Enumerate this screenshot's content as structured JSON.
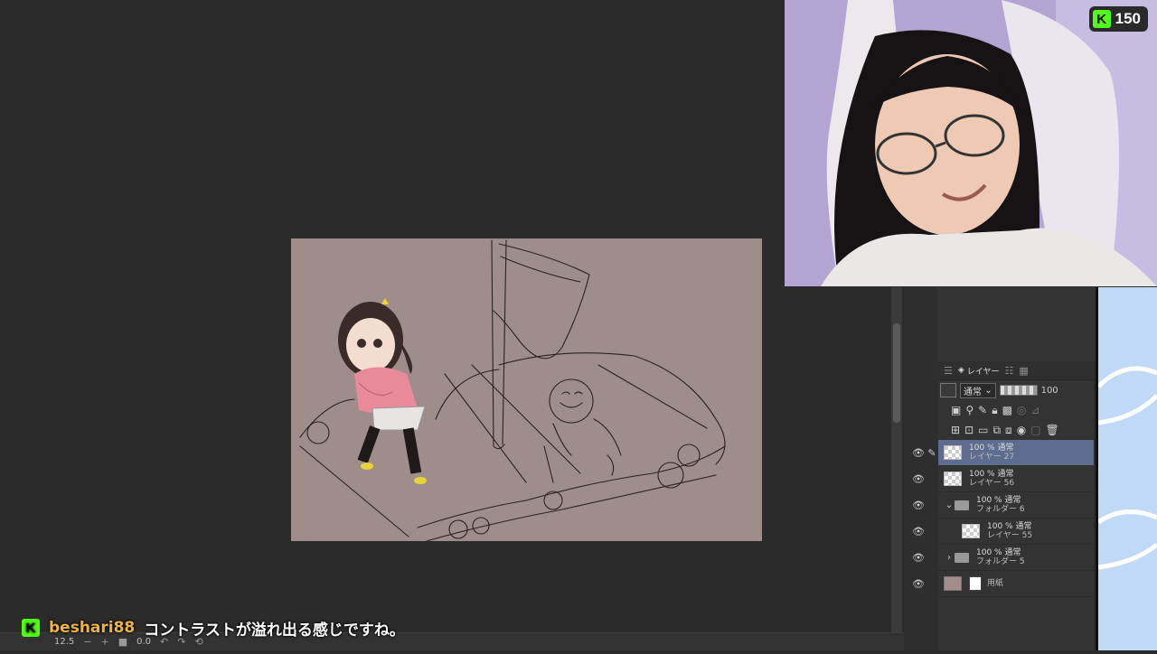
{
  "status_bar": {
    "zoom": "12.5",
    "rotation": "0.0",
    "minus": "−",
    "plus": "+"
  },
  "stream_badge": {
    "logo_letter": "K",
    "count": "150"
  },
  "layer_panel": {
    "tab_label": "レイヤー",
    "blend_mode": "通常",
    "opacity": "100",
    "layers": [
      {
        "mode": "100 % 通常",
        "name": "レイヤー 27",
        "type": "raster",
        "selected": true
      },
      {
        "mode": "100 % 通常",
        "name": "レイヤー 56",
        "type": "raster",
        "selected": false
      },
      {
        "mode": "100 % 通常",
        "name": "フォルダー 6",
        "type": "folder-open",
        "selected": false
      },
      {
        "mode": "100 % 通常",
        "name": "レイヤー 55",
        "type": "raster",
        "selected": false
      },
      {
        "mode": "100 % 通常",
        "name": "フォルダー 5",
        "type": "folder-closed",
        "selected": false
      },
      {
        "name": "用紙",
        "type": "paper",
        "selected": false
      }
    ]
  },
  "chat": {
    "platform_letter": "K",
    "username": "beshari88",
    "message": "コントラストが溢れ出る感じですね。"
  },
  "colors": {
    "canvas": "#9f8d8b",
    "selected_layer": "#5d6c8f",
    "kick_green": "#53fc18",
    "username": "#f0b43c"
  }
}
